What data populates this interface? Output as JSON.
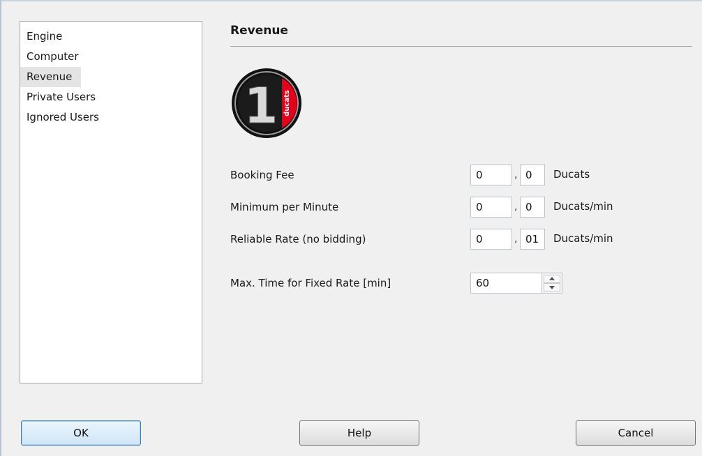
{
  "sidebar": {
    "items": [
      {
        "label": "Engine"
      },
      {
        "label": "Computer"
      },
      {
        "label": "Revenue",
        "selected": true
      },
      {
        "label": "Private Users"
      },
      {
        "label": "Ignored Users"
      }
    ]
  },
  "page": {
    "title": "Revenue",
    "logo": {
      "digit": "1",
      "text": "ducats",
      "icon": "ducats-coin-logo"
    }
  },
  "form": {
    "booking_fee": {
      "label": "Booking Fee",
      "int": "0",
      "frac": "0",
      "sep": ",",
      "unit": "Ducats"
    },
    "min_per_minute": {
      "label": "Minimum per Minute",
      "int": "0",
      "frac": "0",
      "sep": ",",
      "unit": "Ducats/min"
    },
    "reliable_rate": {
      "label": "Reliable Rate (no bidding)",
      "int": "0",
      "frac": "01",
      "sep": ",",
      "unit": "Ducats/min"
    },
    "max_time": {
      "label": "Max. Time for Fixed Rate [min]",
      "value": "60"
    }
  },
  "buttons": {
    "ok": "OK",
    "help": "Help",
    "cancel": "Cancel"
  },
  "colors": {
    "logo_red": "#e3001b",
    "logo_black": "#111111",
    "default_button": "#cfe5f6"
  }
}
